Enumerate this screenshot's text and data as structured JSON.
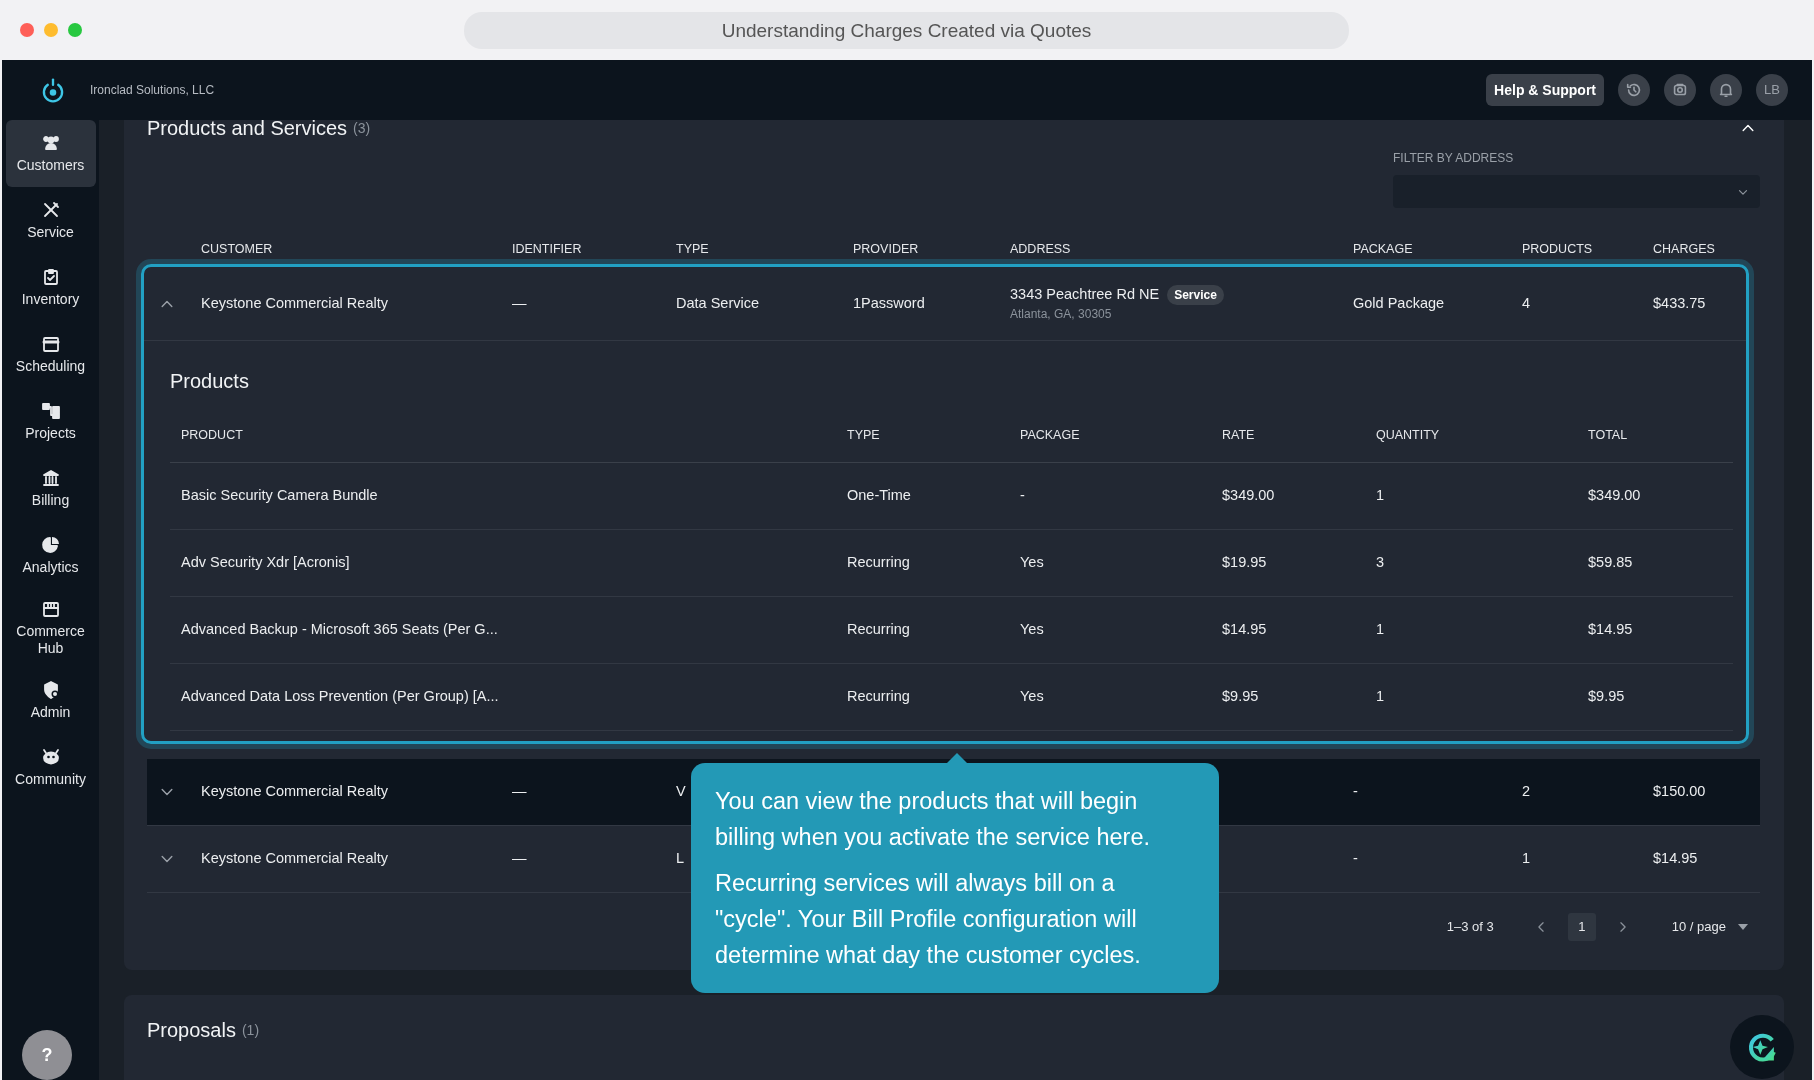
{
  "browser": {
    "title": "Understanding Charges Created via Quotes"
  },
  "header": {
    "company": "Ironclad Solutions, LLC",
    "help_button": "Help & Support",
    "avatar": "LB"
  },
  "sidebar": {
    "items": [
      {
        "label": "Customers",
        "selected": true
      },
      {
        "label": "Service",
        "selected": false
      },
      {
        "label": "Inventory",
        "selected": false
      },
      {
        "label": "Scheduling",
        "selected": false
      },
      {
        "label": "Projects",
        "selected": false
      },
      {
        "label": "Billing",
        "selected": false
      },
      {
        "label": "Analytics",
        "selected": false
      },
      {
        "label": "Commerce Hub",
        "selected": false
      },
      {
        "label": "Admin",
        "selected": false
      },
      {
        "label": "Community",
        "selected": false
      }
    ],
    "help": "?"
  },
  "section": {
    "title": "Products and Services",
    "count": "(3)",
    "expanded": true,
    "filter": {
      "label": "FILTER BY ADDRESS"
    },
    "columns": [
      "CUSTOMER",
      "IDENTIFIER",
      "TYPE",
      "PROVIDER",
      "ADDRESS",
      "PACKAGE",
      "PRODUCTS",
      "CHARGES"
    ],
    "rows": [
      {
        "expanded": true,
        "hovered": false,
        "customer": "Keystone Commercial Realty",
        "identifier": "—",
        "type": "Data Service",
        "provider": "1Password",
        "street": "3343 Peachtree Rd NE",
        "badge": "Service",
        "city": "Atlanta, GA, 30305",
        "package": "Gold Package",
        "products": "4",
        "charges": "$433.75",
        "products_table": {
          "title": "Products",
          "columns": [
            "PRODUCT",
            "TYPE",
            "PACKAGE",
            "RATE",
            "QUANTITY",
            "TOTAL"
          ],
          "rows": [
            [
              "Basic Security Camera Bundle",
              "One-Time",
              "-",
              "$349.00",
              "1",
              "$349.00"
            ],
            [
              "Adv Security Xdr [Acronis]",
              "Recurring",
              "Yes",
              "$19.95",
              "3",
              "$59.85"
            ],
            [
              "Advanced Backup - Microsoft 365 Seats (Per G...",
              "Recurring",
              "Yes",
              "$14.95",
              "1",
              "$14.95"
            ],
            [
              "Advanced Data Loss Prevention (Per Group) [A...",
              "Recurring",
              "Yes",
              "$9.95",
              "1",
              "$9.95"
            ]
          ]
        }
      },
      {
        "expanded": false,
        "hovered": true,
        "customer": "Keystone Commercial Realty",
        "identifier": "—",
        "type": "V",
        "package": "-",
        "products": "2",
        "charges": "$150.00"
      },
      {
        "expanded": false,
        "hovered": false,
        "customer": "Keystone Commercial Realty",
        "identifier": "—",
        "type": "L",
        "package": "-",
        "products": "1",
        "charges": "$14.95"
      }
    ],
    "pagination": {
      "range": "1–3 of 3",
      "page": "1",
      "page_size": "10 / page"
    }
  },
  "tooltip": {
    "paragraphs": [
      "You can view the products that will begin billing when you activate the service here.",
      "Recurring services will always bill on a \"cycle\". Your Bill Profile configuration will determine what day the customer cycles."
    ]
  },
  "proposals": {
    "title": "Proposals",
    "count": "(1)"
  }
}
